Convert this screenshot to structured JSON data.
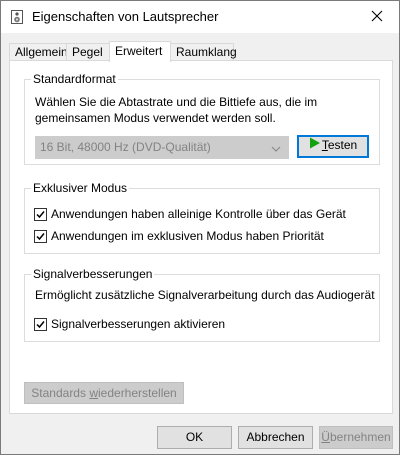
{
  "window": {
    "title": "Eigenschaften von Lautsprecher"
  },
  "tabs": [
    {
      "label": "Allgemein",
      "active": false
    },
    {
      "label": "Pegel",
      "active": false
    },
    {
      "label": "Erweitert",
      "active": true
    },
    {
      "label": "Raumklang",
      "active": false
    }
  ],
  "standardformat": {
    "title": "Standardformat",
    "description_line1": "Wählen Sie die Abtastrate und die Bittiefe aus, die im",
    "description_line2": "gemeinsamen Modus verwendet werden soll.",
    "format_value": "16 Bit, 48000 Hz (DVD-Qualität)",
    "test_button": {
      "prefix": "",
      "accel": "T",
      "rest": "esten"
    }
  },
  "exclusive": {
    "title": "Exklusiver Modus",
    "options": [
      {
        "label": "Anwendungen haben alleinige Kontrolle über das Gerät",
        "checked": true
      },
      {
        "label": "Anwendungen im exklusiven Modus haben Priorität",
        "checked": true
      }
    ]
  },
  "enhancements": {
    "title": "Signalverbesserungen",
    "description": "Ermöglicht zusätzliche Signalverarbeitung durch das Audiogerät",
    "option": {
      "label": "Signalverbesserungen aktivieren",
      "checked": true
    }
  },
  "restore_button": {
    "prefix": "Standards ",
    "accel": "w",
    "rest": "iederherstellen"
  },
  "footer": {
    "ok": "OK",
    "cancel": "Abbrechen",
    "apply": {
      "prefix": "",
      "accel": "Ü",
      "rest": "bernehmen"
    }
  },
  "colors": {
    "accent": "#0078d7",
    "play_green": "#13a10e",
    "disabled_text": "#838383"
  },
  "icons": {
    "title": "speaker-icon",
    "close": "close-icon",
    "dropdown": "chevron-down-icon",
    "test": "play-icon",
    "check": "checkmark-icon"
  }
}
